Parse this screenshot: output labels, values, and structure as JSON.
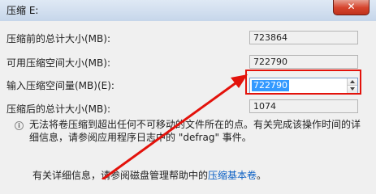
{
  "window": {
    "title": "压缩 E:",
    "close_glyph": "✕"
  },
  "rows": [
    {
      "label": "压缩前的总计大小(MB):",
      "value": "723864"
    },
    {
      "label": "可用压缩空间大小(MB):",
      "value": "722790"
    },
    {
      "label": "输入压缩空间量(MB)(E):",
      "value": "722790"
    },
    {
      "label": "压缩后的总计大小(MB):",
      "value": "1074"
    }
  ],
  "info": {
    "icon": "info-icon",
    "text": "无法将卷压缩到超出任何不可移动的文件所在的点。有关完成该操作时间的详细信息，请参阅应用程序日志中的 \"defrag\" 事件。"
  },
  "details": {
    "prefix": "有关详细信息，请参阅磁盘管理帮助中的",
    "link_text": "压缩基本卷",
    "suffix": "。"
  },
  "annotation": {
    "highlight_color": "#e3120b"
  }
}
